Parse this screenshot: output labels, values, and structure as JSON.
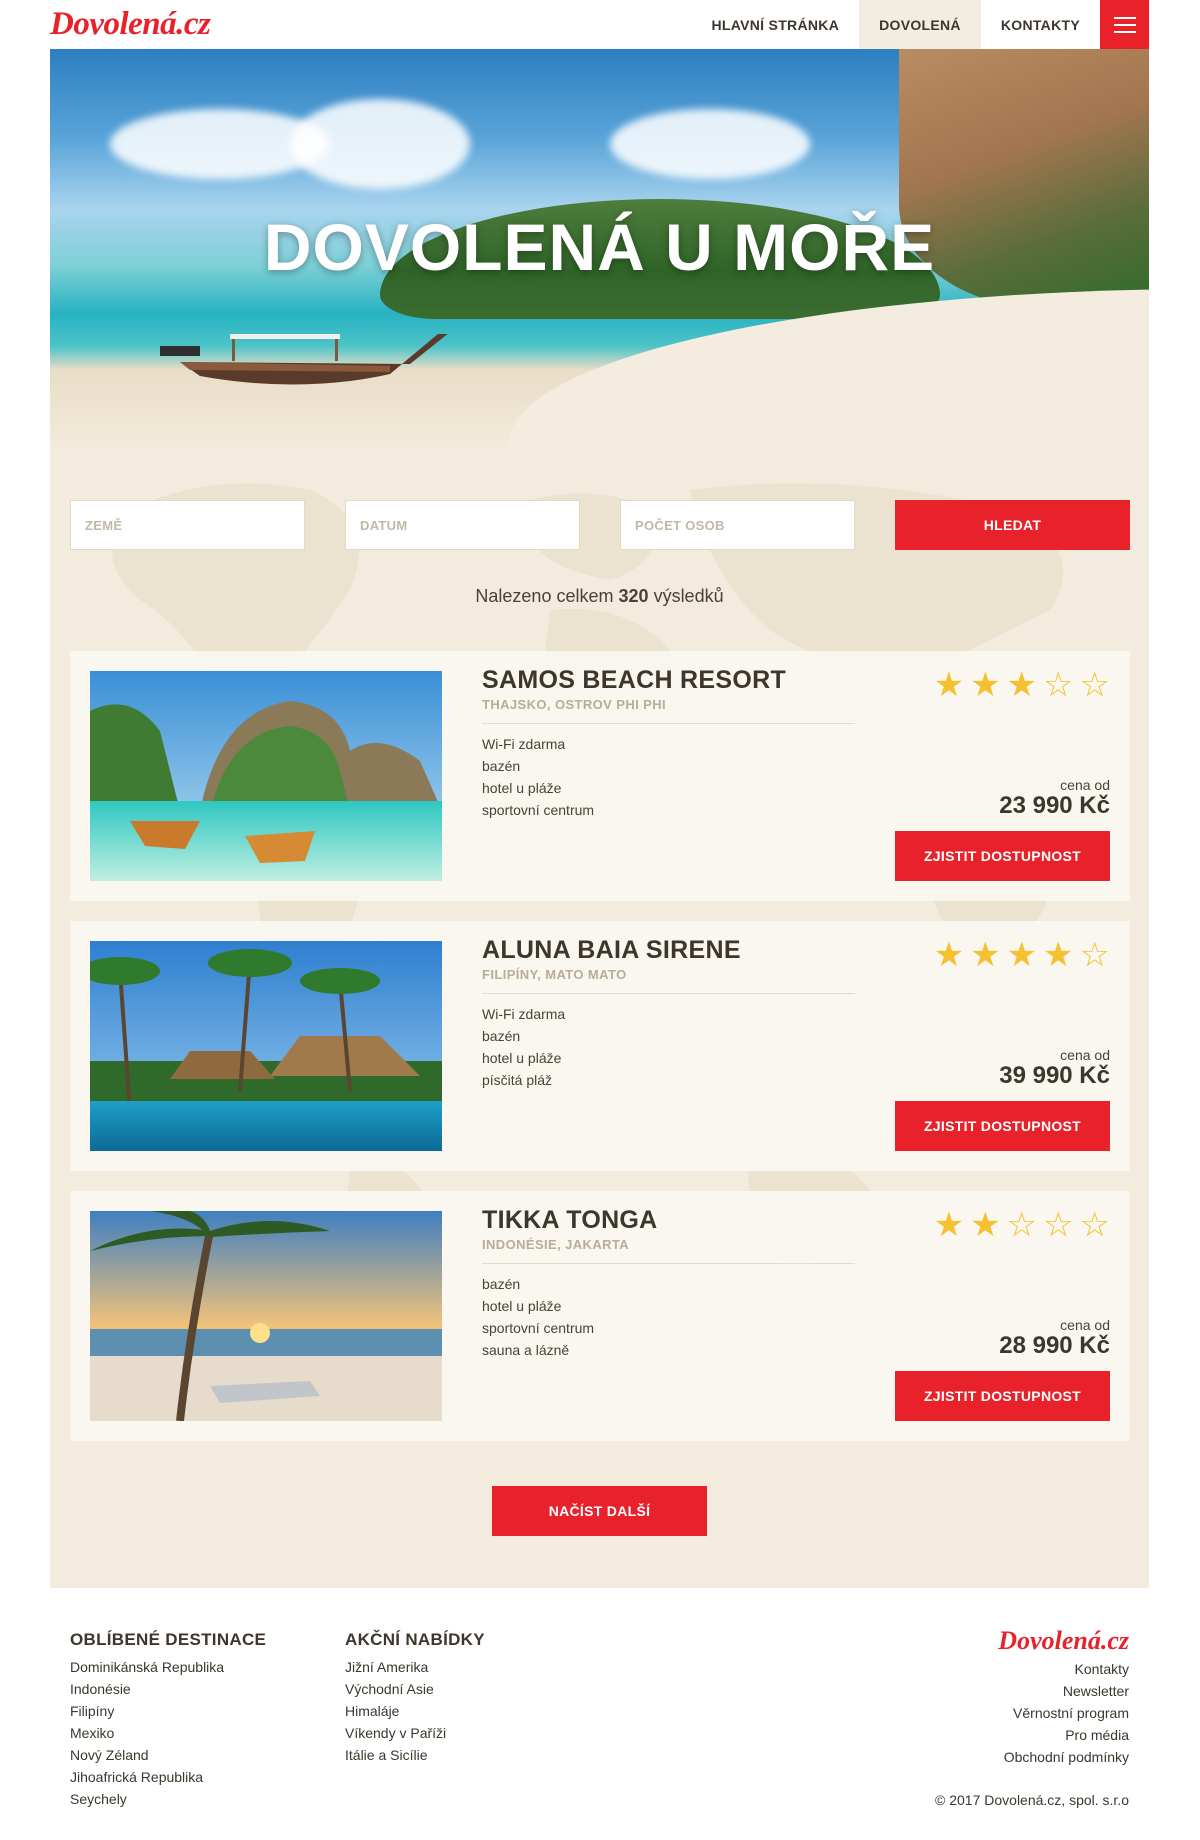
{
  "brand": {
    "logo": "Dovolená.cz",
    "accent_color": "#e8212b"
  },
  "nav": {
    "items": [
      {
        "label": "HLAVNÍ STRÁNKA",
        "active": false
      },
      {
        "label": "DOVOLENÁ",
        "active": true
      },
      {
        "label": "KONTAKTY",
        "active": false
      }
    ],
    "menu_icon": "hamburger-icon"
  },
  "hero": {
    "title": "DOVOLENÁ U MOŘE"
  },
  "search": {
    "country_placeholder": "ZEMĚ",
    "date_placeholder": "DATUM",
    "people_placeholder": "POČET OSOB",
    "button_label": "HLEDAT"
  },
  "results": {
    "prefix": "Nalezeno celkem",
    "count": "320",
    "suffix": "výsledků"
  },
  "hotels": [
    {
      "name": "SAMOS BEACH RESORT",
      "location": "THAJSKO, OSTROV PHI PHI",
      "features": [
        "Wi-Fi zdarma",
        "bazén",
        "hotel u pláže",
        "sportovní centrum"
      ],
      "rating": 3,
      "max_rating": 5,
      "price_label": "cena od",
      "price": "23 990 Kč",
      "button_label": "ZJISTIT DOSTUPNOST"
    },
    {
      "name": "ALUNA BAIA SIRENE",
      "location": "FILIPÍNY, MATO MATO",
      "features": [
        "Wi-Fi zdarma",
        "bazén",
        "hotel u pláže",
        "písčitá pláž"
      ],
      "rating": 4,
      "max_rating": 5,
      "price_label": "cena od",
      "price": "39 990 Kč",
      "button_label": "ZJISTIT DOSTUPNOST"
    },
    {
      "name": "TIKKA TONGA",
      "location": "INDONÉSIE, JAKARTA",
      "features": [
        "bazén",
        "hotel u pláže",
        "sportovní centrum",
        "sauna a lázně"
      ],
      "rating": 2,
      "max_rating": 5,
      "price_label": "cena od",
      "price": "28 990 Kč",
      "button_label": "ZJISTIT DOSTUPNOST"
    }
  ],
  "load_more": {
    "label": "NAČÍST DALŠÍ"
  },
  "footer": {
    "col1": {
      "title": "OBLÍBENÉ DESTINACE",
      "items": [
        "Dominikánská Republika",
        "Indonésie",
        "Filipíny",
        "Mexiko",
        "Nový Zéland",
        "Jihoafrická Republika",
        "Seychely"
      ]
    },
    "col2": {
      "title": "AKČNÍ NABÍDKY",
      "items": [
        "Jižní Amerika",
        "Východní Asie",
        "Himaláje",
        "Víkendy v Paříži",
        "Itálie a Sicílie"
      ]
    },
    "logo": "Dovolená.cz",
    "links": [
      "Kontakty",
      "Newsletter",
      "Věrnostní program",
      "Pro média",
      "Obchodní podmínky"
    ],
    "copyright": "© 2017 Dovolená.cz, spol. s.r.o"
  }
}
